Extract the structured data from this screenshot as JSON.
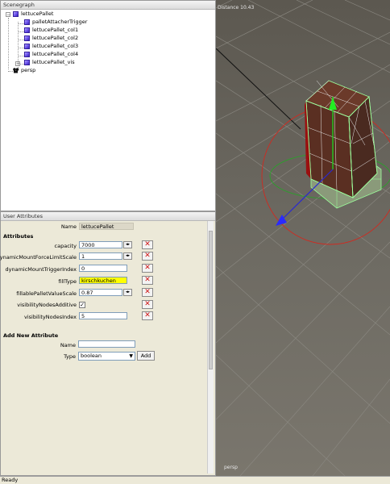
{
  "scenegraph": {
    "title": "Scenegraph",
    "items": [
      {
        "label": "lettucePallet",
        "expander": "−"
      },
      {
        "label": "palletAttacherTrigger"
      },
      {
        "label": "lettucePallet_col1"
      },
      {
        "label": "lettucePallet_col2"
      },
      {
        "label": "lettucePallet_col3"
      },
      {
        "label": "lettucePallet_col4"
      },
      {
        "label": "lettucePallet_vis",
        "expander": "+"
      },
      {
        "label": "persp"
      }
    ]
  },
  "attributes": {
    "title": "User Attributes",
    "name_label": "Name",
    "name_value": "lettucePallet",
    "section_attributes": "Attributes",
    "rows": [
      {
        "label": "capacity",
        "value": "7000",
        "spinner": "◂▸"
      },
      {
        "label": "dynamicMountForceLimitScale",
        "value": "1",
        "spinner": "◂▸"
      },
      {
        "label": "dynamicMountTriggerIndex",
        "value": "0"
      },
      {
        "label": "fillType",
        "value": "kirschkuchen"
      },
      {
        "label": "fillablePalletValueScale",
        "value": "0.87",
        "spinner": "◂▸"
      },
      {
        "label": "visibilityNodesAdditive",
        "value": "✓"
      },
      {
        "label": "visibilityNodesIndex",
        "value": "5"
      }
    ],
    "delete_glyph": "✕",
    "section_new": "Add New Attribute",
    "new_name_label": "Name",
    "new_name_value": "",
    "new_type_label": "Type",
    "new_type_value": "boolean",
    "add_button": "Add"
  },
  "viewport": {
    "distance": "Distance 10.43",
    "camera": "persp"
  },
  "status": {
    "text": "Ready"
  }
}
